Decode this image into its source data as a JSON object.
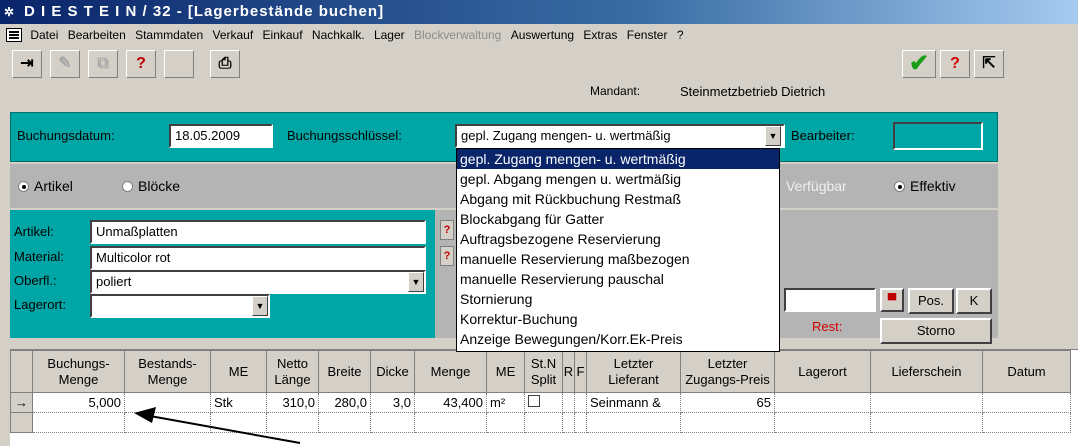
{
  "window": {
    "app_icon": "app-icon",
    "title": "D I E S T E I N / 32 - [Lagerbestände buchen]"
  },
  "menu": {
    "items": [
      {
        "label": "Datei",
        "enabled": true
      },
      {
        "label": "Bearbeiten",
        "enabled": true
      },
      {
        "label": "Stammdaten",
        "enabled": true
      },
      {
        "label": "Verkauf",
        "enabled": true
      },
      {
        "label": "Einkauf",
        "enabled": true
      },
      {
        "label": "Nachkalk.",
        "enabled": true
      },
      {
        "label": "Lager",
        "enabled": true
      },
      {
        "label": "Blockverwaltung",
        "enabled": false
      },
      {
        "label": "Auswertung",
        "enabled": true
      },
      {
        "label": "Extras",
        "enabled": true
      },
      {
        "label": "Fenster",
        "enabled": true
      },
      {
        "label": "?",
        "enabled": true
      }
    ]
  },
  "toolbar": {
    "mandant_label": "Mandant:",
    "mandant_value": "Steinmetzbetrieb Dietrich",
    "icons": [
      "insert-row-icon",
      "delete-icon",
      "copy-icon",
      "help-query-icon",
      "blank-icon",
      "print-icon",
      "ok-check-icon",
      "help-icon",
      "exit-door-icon"
    ]
  },
  "header": {
    "buchungsdatum_label": "Buchungsdatum:",
    "buchungsdatum_value": "18.05.2009",
    "buchungsschluessel_label": "Buchungsschlüssel:",
    "buchungsschluessel_value": "gepl. Zugang mengen- u. wertmäßig",
    "bearbeiter_label": "Bearbeiter:",
    "bearbeiter_value": ""
  },
  "radios": {
    "artikel": "Artikel",
    "bloecke": "Blöcke",
    "verfuegbar": "Verfügbar",
    "effektiv": "Effektiv"
  },
  "article": {
    "artikel_label": "Artikel:",
    "artikel_value": "Unmaßplatten",
    "material_label": "Material:",
    "material_value": "Multicolor rot",
    "oberfl_label": "Oberfl.:",
    "oberfl_value": "poliert",
    "lagerort_label": "Lagerort:",
    "lagerort_value": "",
    "rest_label": "Rest:",
    "pos_button": "Pos.",
    "k_button": "K",
    "storno_button": "Storno"
  },
  "dropdown_options": [
    "gepl. Zugang mengen- u. wertmäßig",
    "gepl. Abgang mengen u. wertmäßig",
    "Abgang mit Rückbuchung Restmaß",
    "Blockabgang für Gatter",
    "Auftragsbezogene Reservierung",
    "manuelle Reservierung maßbezogen",
    "manuelle Reservierung pauschal",
    "Stornierung",
    "Korrektur-Buchung",
    "Anzeige Bewegungen/Korr.Ek-Preis"
  ],
  "grid": {
    "headers": [
      "Buchungs-\nMenge",
      "Bestands-\nMenge",
      "ME",
      "Netto\nLänge",
      "Breite",
      "Dicke",
      "Menge",
      "ME",
      "St.N\nSplit",
      "R",
      "F",
      "Letzter\nLieferant",
      "Letzter\nZugangs-Preis",
      "Lagerort",
      "Lieferschein",
      "Datum"
    ],
    "rows": [
      {
        "indicator": "→",
        "cells": [
          "5,000",
          "",
          "Stk",
          "310,0",
          "280,0",
          "3,0",
          "43,400",
          "m²",
          "",
          "",
          "",
          "Seinmann &",
          "65",
          "",
          "",
          ""
        ]
      }
    ]
  }
}
